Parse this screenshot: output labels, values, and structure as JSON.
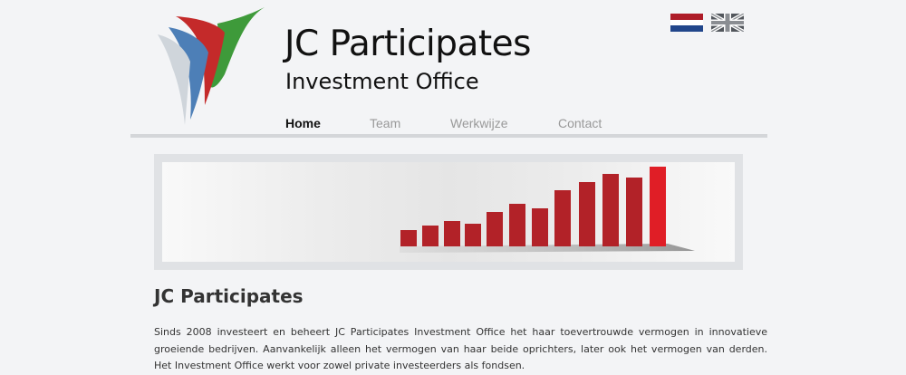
{
  "brand": {
    "title": "JC Participates",
    "subtitle": "Investment Office"
  },
  "language_flags": [
    {
      "icon": "netherlands-flag-icon",
      "colors": [
        "#ae1c28",
        "#ffffff",
        "#21468b"
      ]
    },
    {
      "icon": "united-kingdom-flag-icon",
      "colors": [
        "#012169",
        "#ffffff",
        "#c8102e"
      ]
    }
  ],
  "nav": {
    "items": [
      {
        "label": "Home",
        "active": true
      },
      {
        "label": "Team",
        "active": false
      },
      {
        "label": "Werkwijze",
        "active": false
      },
      {
        "label": "Contact",
        "active": false
      }
    ]
  },
  "banner": {
    "icon": "growth-bar-chart-graphic",
    "colors": {
      "bar": "#b22228",
      "highlight": "#e01e26"
    }
  },
  "main": {
    "heading": "JC Participates",
    "intro": "Sinds 2008 investeert en beheert JC Participates Investment Office het haar toevertrouwde vermogen in innovatieve groeiende bedrijven. Aanvankelijk alleen het vermogen van haar beide oprichters, later ook het vermogen van derden. Het Investment Office werkt voor zowel private investeerders als fondsen."
  },
  "colors": {
    "background": "#f3f4f6",
    "nav_active": "#111111",
    "nav_inactive": "#999999",
    "rule": "#d4d6d9"
  }
}
